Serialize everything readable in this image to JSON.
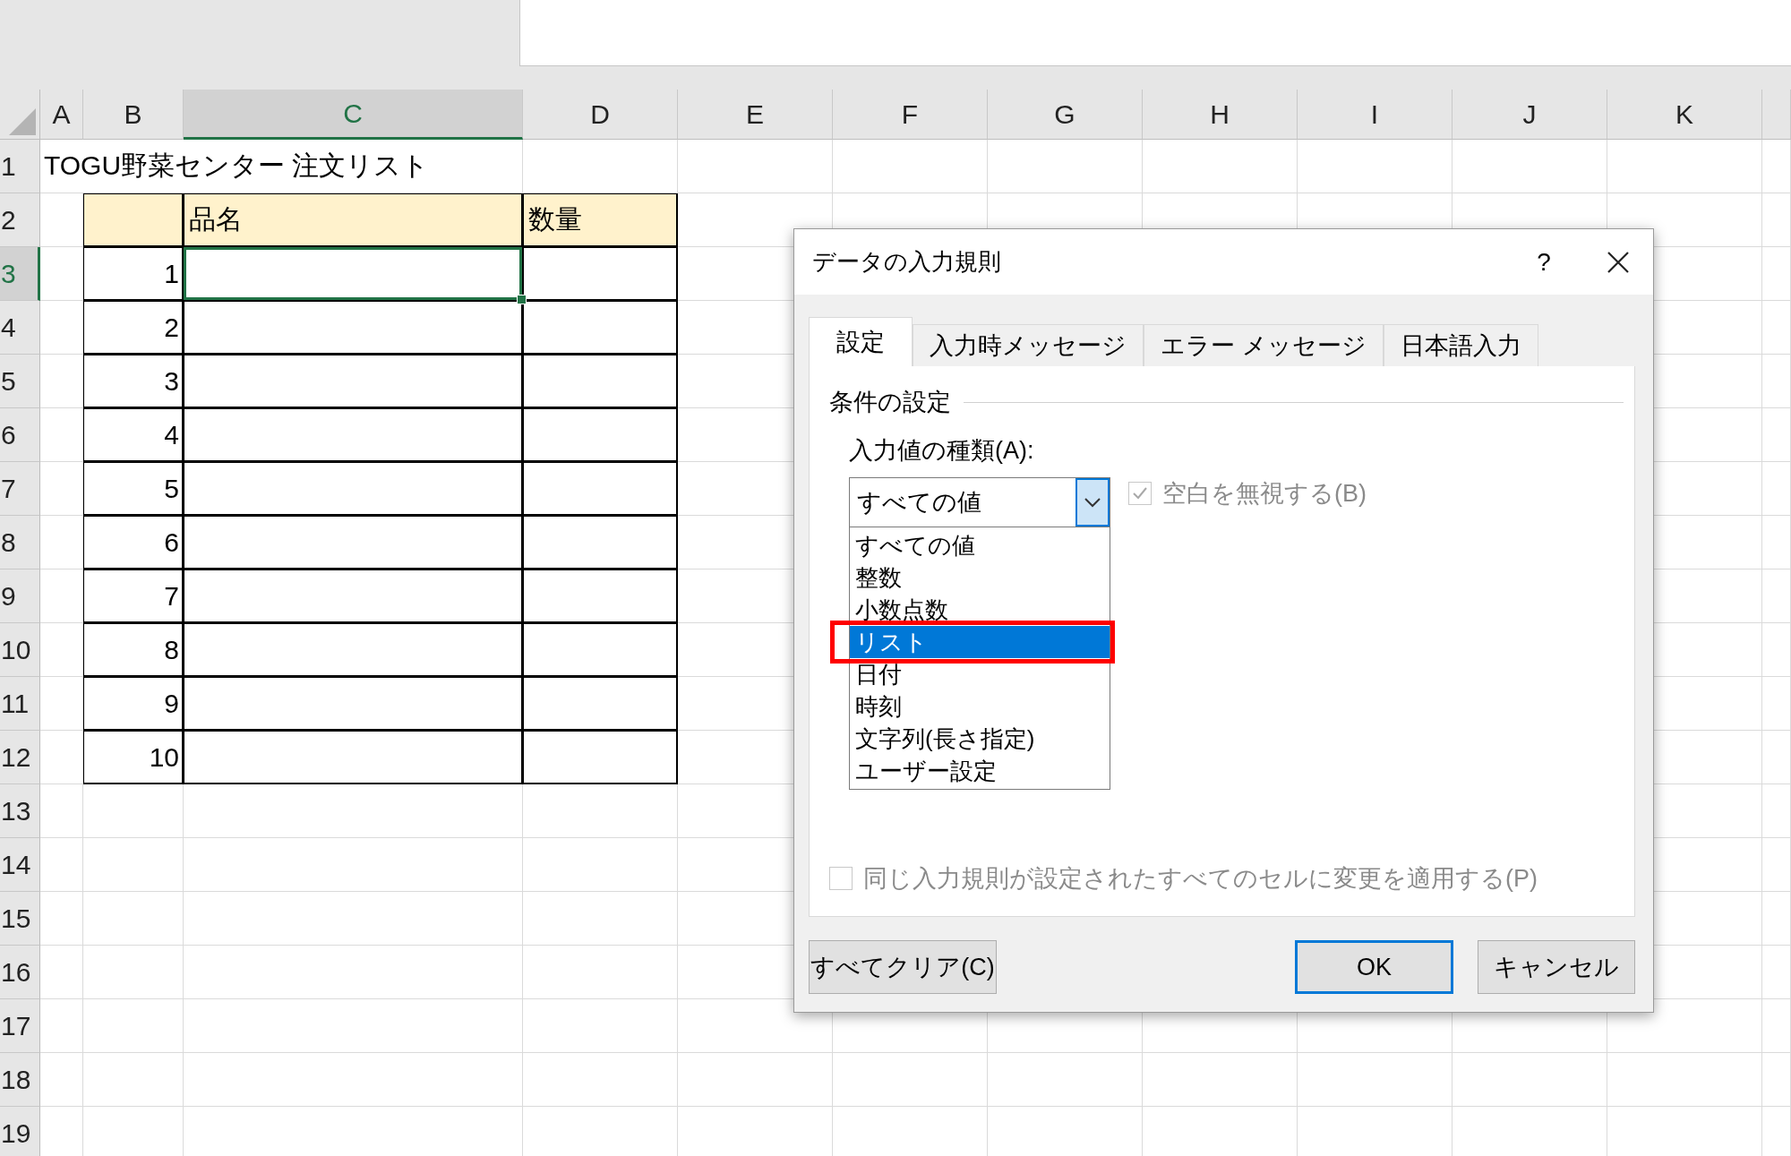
{
  "sheet": {
    "columns": [
      {
        "label": "A",
        "selected": false
      },
      {
        "label": "B",
        "selected": false
      },
      {
        "label": "C",
        "selected": true
      },
      {
        "label": "D",
        "selected": false
      },
      {
        "label": "E",
        "selected": false
      },
      {
        "label": "F",
        "selected": false
      },
      {
        "label": "G",
        "selected": false
      },
      {
        "label": "H",
        "selected": false
      },
      {
        "label": "I",
        "selected": false
      },
      {
        "label": "J",
        "selected": false
      },
      {
        "label": "K",
        "selected": false
      }
    ],
    "rows": [
      {
        "label": "1",
        "selected": false
      },
      {
        "label": "2",
        "selected": false
      },
      {
        "label": "3",
        "selected": true
      },
      {
        "label": "4",
        "selected": false
      },
      {
        "label": "5",
        "selected": false
      },
      {
        "label": "6",
        "selected": false
      },
      {
        "label": "7",
        "selected": false
      },
      {
        "label": "8",
        "selected": false
      },
      {
        "label": "9",
        "selected": false
      },
      {
        "label": "10",
        "selected": false
      },
      {
        "label": "11",
        "selected": false
      },
      {
        "label": "12",
        "selected": false
      },
      {
        "label": "13",
        "selected": false
      },
      {
        "label": "14",
        "selected": false
      },
      {
        "label": "15",
        "selected": false
      },
      {
        "label": "16",
        "selected": false
      },
      {
        "label": "17",
        "selected": false
      },
      {
        "label": "18",
        "selected": false
      },
      {
        "label": "19",
        "selected": false
      }
    ],
    "title": "TOGU野菜センター 注文リスト",
    "table": {
      "headers": [
        "品名",
        "数量"
      ],
      "numbers": [
        "1",
        "2",
        "3",
        "4",
        "5",
        "6",
        "7",
        "8",
        "9",
        "10"
      ]
    }
  },
  "dialog": {
    "title": "データの入力規則",
    "help": "?",
    "tabs": [
      {
        "label": "設定",
        "selected": true
      },
      {
        "label": "入力時メッセージ",
        "selected": false
      },
      {
        "label": "エラー メッセージ",
        "selected": false
      },
      {
        "label": "日本語入力",
        "selected": false
      }
    ],
    "group_label": "条件の設定",
    "type_label": "入力値の種類(A):",
    "type_combo": {
      "value": "すべての値",
      "expanded": true
    },
    "options": [
      {
        "label": "すべての値",
        "selected": false
      },
      {
        "label": "整数",
        "selected": false
      },
      {
        "label": "小数点数",
        "selected": false
      },
      {
        "label": "リスト",
        "selected": true
      },
      {
        "label": "日付",
        "selected": false
      },
      {
        "label": "時刻",
        "selected": false
      },
      {
        "label": "文字列(長さ指定)",
        "selected": false
      },
      {
        "label": "ユーザー設定",
        "selected": false
      }
    ],
    "ignore_blank": {
      "label": "空白を無視する(B)",
      "checked": true,
      "disabled": true
    },
    "apply_all": {
      "label": "同じ入力規則が設定されたすべてのセルに変更を適用する(P)",
      "checked": false,
      "disabled": true
    },
    "buttons": [
      {
        "label": "すべてクリア(C)",
        "default": false
      },
      {
        "label": "OK",
        "default": true
      },
      {
        "label": "キャンセル",
        "default": false
      }
    ]
  }
}
